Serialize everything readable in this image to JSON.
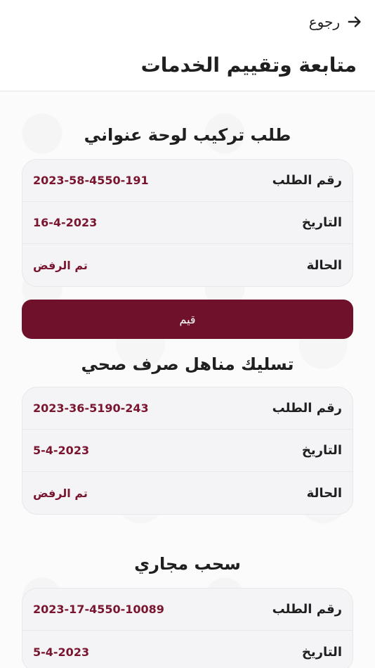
{
  "header": {
    "back_label": "رجوع",
    "title": "متابعة وتقييم الخدمات"
  },
  "services": [
    {
      "title": "طلب تركيب لوحة عنواني",
      "rows": [
        {
          "label": "رقم الطلب",
          "value": "2023-58-4550-191"
        },
        {
          "label": "التاريخ",
          "value": "16-4-2023"
        },
        {
          "label": "الحالة",
          "value": "تم الرفض"
        }
      ],
      "action_label": "قيم"
    },
    {
      "title": "تسليك مناهل صرف صحي",
      "rows": [
        {
          "label": "رقم الطلب",
          "value": "2023-36-5190-243"
        },
        {
          "label": "التاريخ",
          "value": "5-4-2023"
        },
        {
          "label": "الحالة",
          "value": "تم الرفض"
        }
      ]
    },
    {
      "title": "سحب مجاري",
      "rows": [
        {
          "label": "رقم الطلب",
          "value": "2023-17-4550-10089"
        },
        {
          "label": "التاريخ",
          "value": "5-4-2023"
        }
      ]
    }
  ],
  "colors": {
    "accent": "#6f112b",
    "value_text": "#7a1530",
    "card_bg": "#f4f4f6"
  }
}
